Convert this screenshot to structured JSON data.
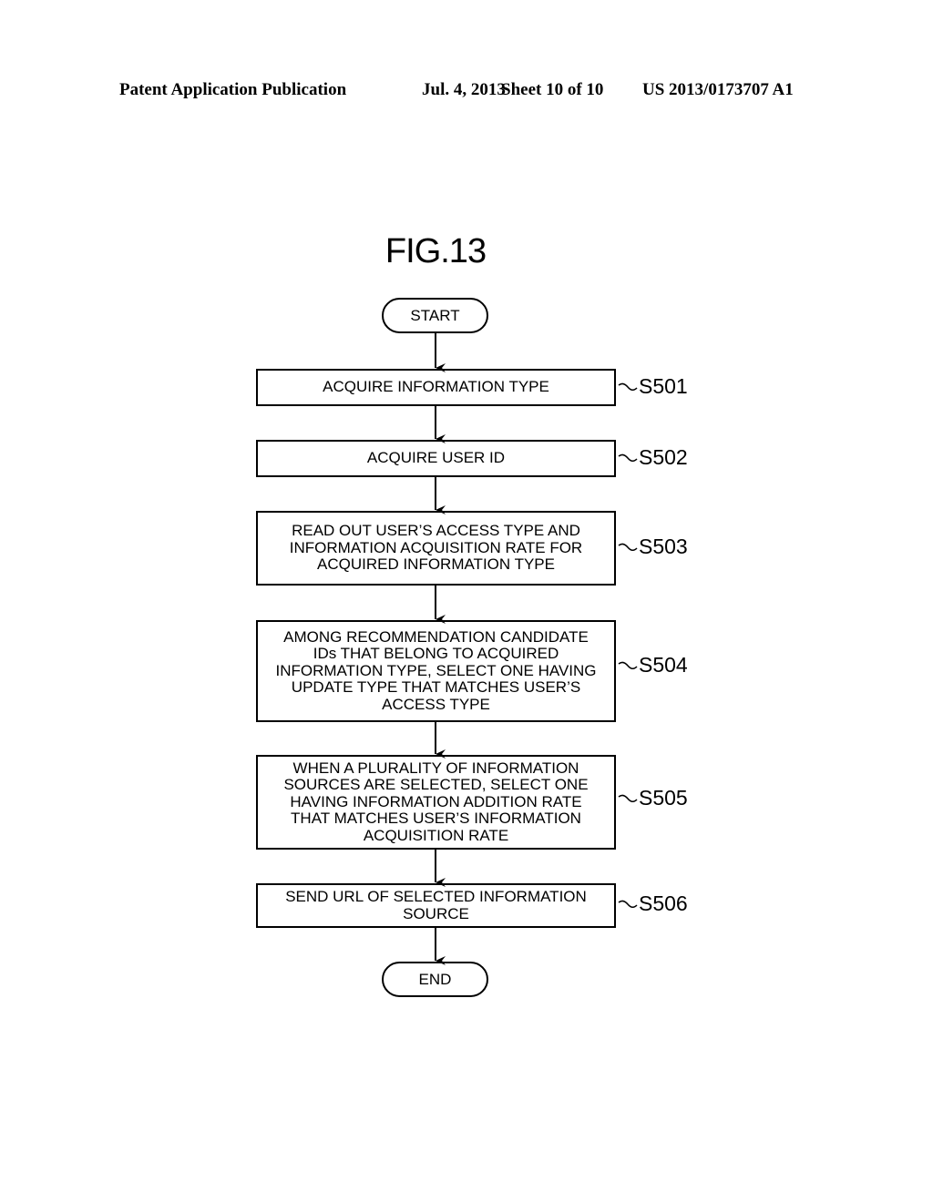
{
  "header": {
    "publication": "Patent Application Publication",
    "date": "Jul. 4, 2013",
    "sheet": "Sheet 10 of 10",
    "number": "US 2013/0173707 A1"
  },
  "figure": {
    "title": "FIG.13",
    "start_label": "START",
    "end_label": "END",
    "steps": [
      {
        "id": "S501",
        "text": "ACQUIRE INFORMATION TYPE"
      },
      {
        "id": "S502",
        "text": "ACQUIRE USER ID"
      },
      {
        "id": "S503",
        "text": "READ OUT USER’S ACCESS TYPE AND\nINFORMATION ACQUISITION RATE FOR\nACQUIRED INFORMATION TYPE"
      },
      {
        "id": "S504",
        "text": "AMONG RECOMMENDATION CANDIDATE\nIDs THAT BELONG TO ACQUIRED\nINFORMATION TYPE, SELECT ONE HAVING\nUPDATE TYPE THAT MATCHES USER’S\nACCESS TYPE"
      },
      {
        "id": "S505",
        "text": "WHEN A PLURALITY OF INFORMATION\nSOURCES ARE SELECTED, SELECT ONE\nHAVING INFORMATION ADDITION RATE\nTHAT MATCHES USER’S INFORMATION\nACQUISITION RATE"
      },
      {
        "id": "S506",
        "text": "SEND URL OF SELECTED INFORMATION\nSOURCE"
      }
    ]
  }
}
